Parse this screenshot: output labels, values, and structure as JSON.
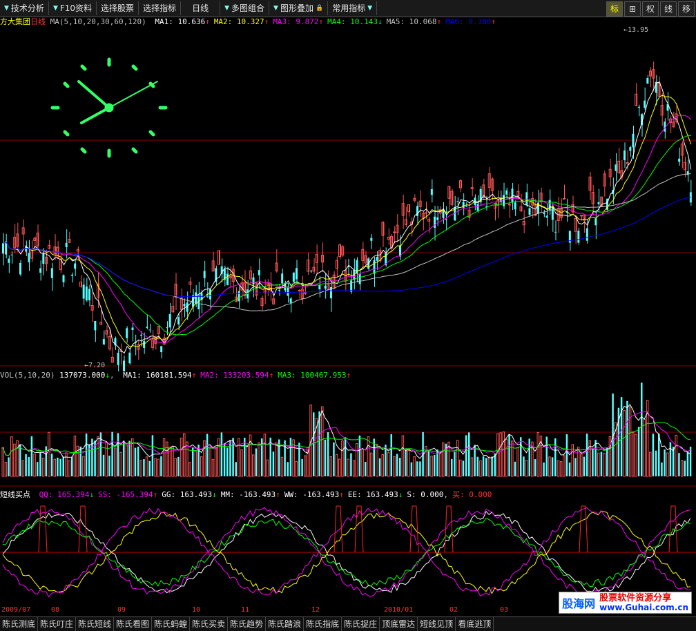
{
  "toolbar": {
    "items": [
      "技术分析",
      "F10资料",
      "选择股票",
      "选择指标",
      "日线",
      "多图组合",
      "图形叠加",
      "常用指标"
    ],
    "right_icons": [
      "标",
      "⊞",
      "权",
      "线",
      "移"
    ]
  },
  "price_panel": {
    "stock_name": "方大集团",
    "period": "日线",
    "indicator": "MA(5,10,20,30,60,120)",
    "ma": [
      {
        "label": "MA1:",
        "value": "10.636",
        "trend": "↑",
        "color": "#ffffff"
      },
      {
        "label": "MA2:",
        "value": "10.327",
        "trend": "↑",
        "color": "#ffff00"
      },
      {
        "label": "MA3:",
        "value": "9.872",
        "trend": "↑",
        "color": "#ff00ff"
      },
      {
        "label": "MA4:",
        "value": "10.143",
        "trend": "↓",
        "color": "#00ff00"
      },
      {
        "label": "MA5:",
        "value": "10.068",
        "trend": "↑",
        "color": "#c0c0c0"
      },
      {
        "label": "MA6:",
        "value": "9.380",
        "trend": "↑",
        "color": "#0000ff"
      }
    ],
    "high_label": "13.95",
    "low_label": "7.20"
  },
  "volume_panel": {
    "indicator": "VOL(5,10,20)",
    "vol_value": "137073.000",
    "vol_trend": "↓",
    "ma": [
      {
        "label": "MA1:",
        "value": "160181.594",
        "trend": "↑",
        "color": "#ffffff"
      },
      {
        "label": "MA2:",
        "value": "133203.594",
        "trend": "↑",
        "color": "#ff00ff"
      },
      {
        "label": "MA3:",
        "value": "100467.953",
        "trend": "↑",
        "color": "#00ff00"
      }
    ]
  },
  "signal_panel": {
    "name": "短线买点",
    "items": [
      {
        "label": "QQ:",
        "value": "165.394",
        "trend": "↓",
        "color": "#ff00ff"
      },
      {
        "label": "SS:",
        "value": "-165.394",
        "trend": "↑",
        "color": "#ff00ff"
      },
      {
        "label": "GG:",
        "value": "163.493",
        "trend": "↓",
        "color": "#ffffff"
      },
      {
        "label": "MM:",
        "value": "-163.493",
        "trend": "↑",
        "color": "#ffffff"
      },
      {
        "label": "WW:",
        "value": "-163.493",
        "trend": "↑",
        "color": "#ffffff"
      },
      {
        "label": "EE:",
        "value": "163.493",
        "trend": "↓",
        "color": "#ffffff"
      },
      {
        "label": "S:",
        "value": "0.000",
        "trend": ",",
        "color": "#ffffff"
      },
      {
        "label": "买:",
        "value": "0.000",
        "trend": "",
        "color": "#ff3333"
      }
    ]
  },
  "time_axis": [
    "2009/07",
    "08",
    "09",
    "10",
    "11",
    "12",
    "2010/01",
    "02",
    "03"
  ],
  "bottom_tabs": [
    "陈氏测底",
    "陈氏叮庄",
    "陈氏短线",
    "陈氏看图",
    "陈氏蚂蝗",
    "陈氏买卖",
    "陈氏趋势",
    "陈氏踏浪",
    "陈氏指底",
    "陈氏捉庄",
    "顶底雷达",
    "短线见顶",
    "看底逃顶"
  ],
  "watermark": {
    "brand": "股海网",
    "line1": "股票软件资源分享",
    "url": "www.Guhai.com.cn"
  }
}
